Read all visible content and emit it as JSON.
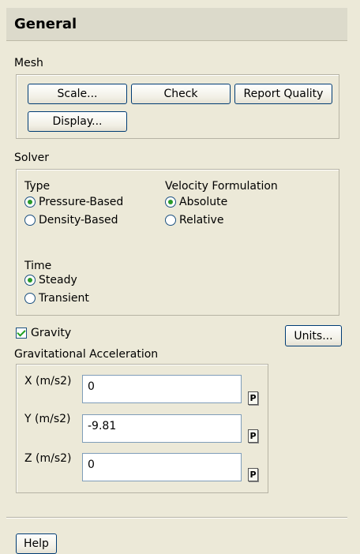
{
  "panel": {
    "title": "General"
  },
  "mesh": {
    "label": "Mesh",
    "scale_button": "Scale...",
    "check_button": "Check",
    "report_quality_button": "Report Quality",
    "display_button": "Display..."
  },
  "solver": {
    "label": "Solver",
    "type": {
      "label": "Type",
      "options": [
        "Pressure-Based",
        "Density-Based"
      ],
      "selected": "Pressure-Based"
    },
    "velocity": {
      "label": "Velocity Formulation",
      "options": [
        "Absolute",
        "Relative"
      ],
      "selected": "Absolute"
    },
    "time": {
      "label": "Time",
      "options": [
        "Steady",
        "Transient"
      ],
      "selected": "Steady"
    }
  },
  "gravity": {
    "checkbox_label": "Gravity",
    "checked": true,
    "units_button": "Units...",
    "group_label": "Gravitational Acceleration",
    "x": {
      "label": "X (m/s2)",
      "value": "0",
      "param_button": "P"
    },
    "y": {
      "label": "Y (m/s2)",
      "value": "-9.81",
      "param_button": "P"
    },
    "z": {
      "label": "Z (m/s2)",
      "value": "0",
      "param_button": "P"
    }
  },
  "footer": {
    "help_button": "Help"
  }
}
